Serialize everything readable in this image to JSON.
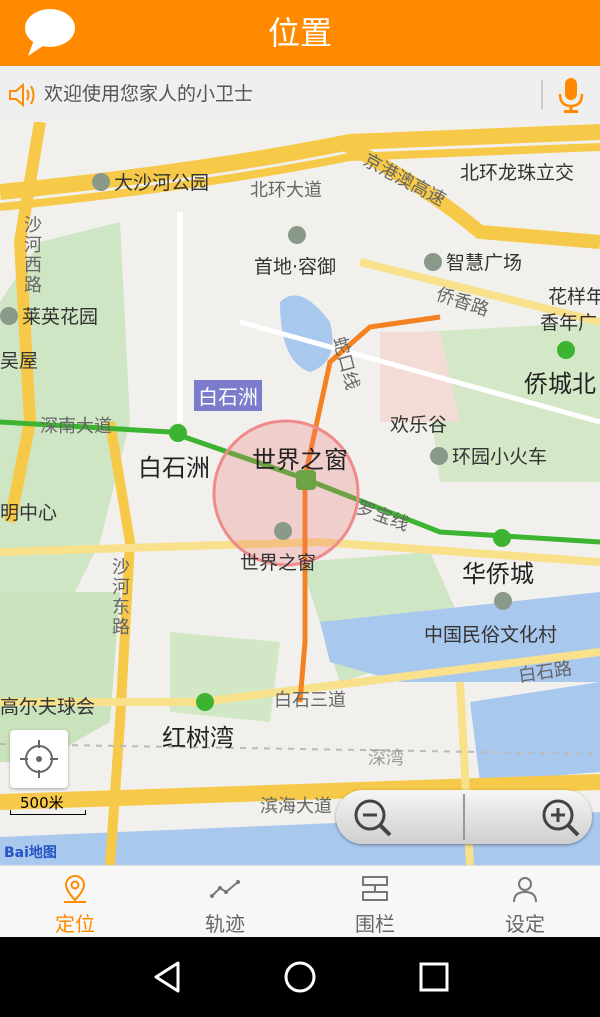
{
  "header": {
    "title": "位置",
    "chat_icon": "chat-bubble-icon"
  },
  "notice": {
    "text": "欢迎使用您家人的小卫士",
    "speaker_icon": "speaker-icon",
    "mic_icon": "microphone-icon"
  },
  "map": {
    "scale_text": "500米",
    "brand": "Bai地图",
    "labels": {
      "dasha_park": "大沙河公园",
      "beihuan": "北环大道",
      "jinggangao": "京港澳高速",
      "beihuan_lz": "北环龙珠立交",
      "shahe_west": "沙河西路",
      "zhihui": "智慧广场",
      "shoudi": "首地·容御",
      "qiaoxiang": "侨香路",
      "huayang": "花样年",
      "xiangnian": "香年广",
      "laiying": "莱英花园",
      "wuwu": "吴屋",
      "baishizhou_hl": "白石洲",
      "shekou": "蛇口线",
      "huanle": "欢乐谷",
      "qiaocheng_n": "侨城北",
      "shennan": "深南大道",
      "baishizhou": "白石洲",
      "window": "世界之窗",
      "huanyuan": "环园小火车",
      "mingzhong": "明中心",
      "luobao": "罗宝线",
      "window_poi": "世界之窗",
      "huaqiao": "华侨城",
      "shahe_east": "沙河东路",
      "folk": "中国民俗文化村",
      "baishi_road": "白石路",
      "golf": "高尔夫球会",
      "baishisan": "白石三道",
      "hongshu": "红树湾",
      "shenwan": "深湾",
      "binhai": "滨海大道"
    }
  },
  "tabs": [
    {
      "label": "定位",
      "icon": "location-pin-icon",
      "active": true
    },
    {
      "label": "轨迹",
      "icon": "track-icon",
      "active": false
    },
    {
      "label": "围栏",
      "icon": "fence-icon",
      "active": false
    },
    {
      "label": "设定",
      "icon": "user-icon",
      "active": false
    }
  ],
  "colors": {
    "accent": "#FF8A00",
    "metro_green": "#3CB431",
    "metro_orange": "#F58220"
  }
}
